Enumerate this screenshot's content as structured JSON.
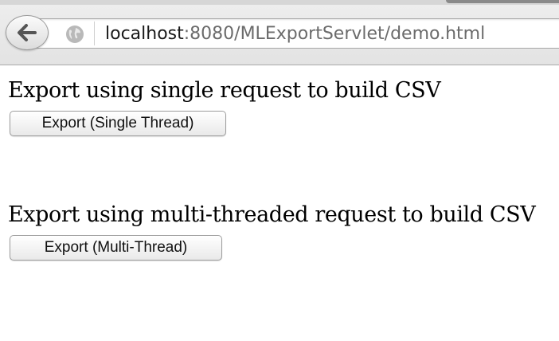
{
  "browser": {
    "back_icon": "back-arrow-icon",
    "site_icon": "globe-icon",
    "url_host": "localhost",
    "url_rest": ":8080/MLExportServlet/demo.html"
  },
  "page": {
    "single": {
      "heading": "Export using single request to build CSV",
      "button_label": "Export (Single Thread)"
    },
    "multi": {
      "heading": "Export using multi-threaded request to build CSV",
      "button_label": "Export (Multi-Thread)"
    }
  }
}
